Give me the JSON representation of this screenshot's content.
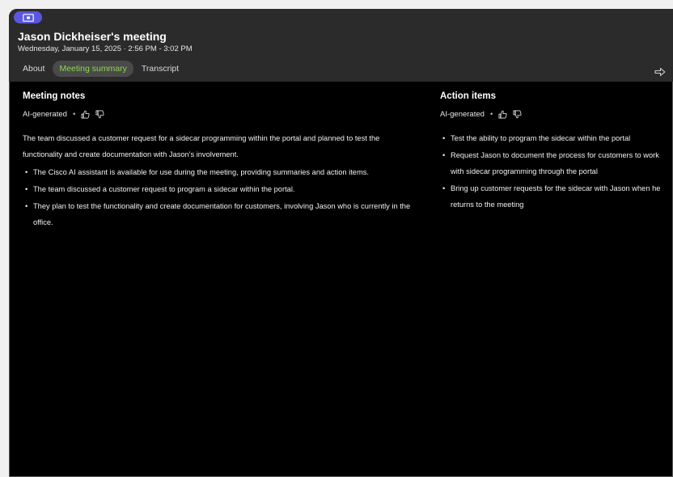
{
  "header": {
    "title": "Jason Dickheiser's meeting",
    "subtitle": "Wednesday, January 15, 2025 · 2:56 PM - 3:02 PM",
    "badge_icon": "presentation-screen-icon",
    "export_icon": "share-arrow-icon"
  },
  "tabs": [
    {
      "label": "About",
      "active": false
    },
    {
      "label": "Meeting summary",
      "active": true
    },
    {
      "label": "Transcript",
      "active": false
    }
  ],
  "meeting_notes": {
    "title": "Meeting notes",
    "ai_label": "AI-generated",
    "intro": "The team discussed a customer request for a sidecar programming within the portal and planned to test the functionality and create documentation with Jason's involvement.",
    "bullets": [
      "The Cisco AI assistant is available for use during the meeting, providing summaries and action items.",
      "The team discussed a customer request to program a sidecar within the portal.",
      "They plan to test the functionality and create documentation for customers, involving Jason who is currently in the office."
    ]
  },
  "action_items": {
    "title": "Action items",
    "ai_label": "AI-generated",
    "bullets": [
      "Test the ability to program the sidecar within the portal",
      "Request Jason to document the process for customers to work with sidecar programming through the portal",
      "Bring up customer requests for the sidecar with Jason when he returns to the meeting"
    ]
  },
  "colors": {
    "header_bg": "#2b2b2b",
    "body_bg": "#000000",
    "accent_green": "#8cd64a",
    "badge_purple": "#5b57e0"
  }
}
